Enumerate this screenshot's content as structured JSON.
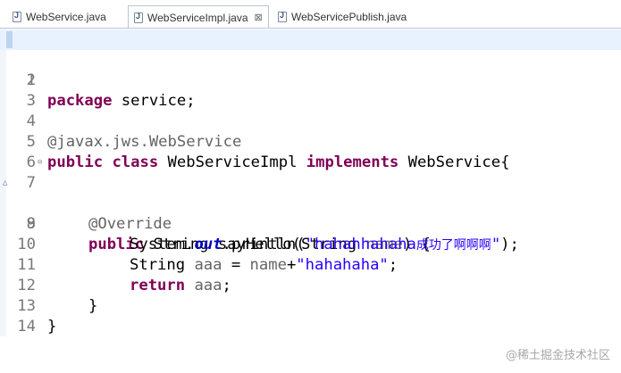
{
  "tabs": [
    {
      "label": "WebService.java",
      "active": false
    },
    {
      "label": "WebServiceImpl.java",
      "active": true,
      "close": "⊠"
    },
    {
      "label": "WebServicePublish.java",
      "active": false
    }
  ],
  "lines": {
    "l1": {
      "num": "1",
      "kw": "package",
      "rest": " service;"
    },
    "l2": {
      "num": "2"
    },
    "l3": {
      "num": "3"
    },
    "l4": {
      "num": "4",
      "ann": "@javax.jws.WebService"
    },
    "l5": {
      "num": "5",
      "kw1": "public",
      "kw2": "class",
      "name": " WebServiceImpl ",
      "kw3": "implements",
      "rest": " WebService{"
    },
    "l6": {
      "num": "6"
    },
    "l7": {
      "num": "7",
      "ann": "@Override"
    },
    "l8": {
      "num": "8",
      "kw": "public",
      "rest1": " String sayHello(String ",
      "param": "name",
      "rest2": ") {"
    },
    "l9": {
      "num": "9",
      "pre": "System.",
      "field": "out",
      "mid": ".println(",
      "str1": "\"hahahhahaha",
      "str_cn": "成功了啊啊啊",
      "str2": "\"",
      "end": ");"
    },
    "l10": {
      "num": "10",
      "pre": "String ",
      "var": "aaa",
      "mid": " = ",
      "param": "name",
      "plus": "+",
      "str": "\"hahahaha\"",
      "end": ";"
    },
    "l11": {
      "num": "11",
      "kw": "return",
      "sp": " ",
      "var": "aaa",
      "end": ";"
    },
    "l12": {
      "num": "12",
      "text": "}"
    },
    "l13": {
      "num": "13",
      "text": "}"
    },
    "l14": {
      "num": "14"
    }
  },
  "markers": {
    "fold": "⊖",
    "override": "△"
  },
  "watermark": "@稀土掘金技术社区",
  "colors": {
    "keyword": "#7f0055",
    "annotation": "#646464",
    "string": "#2a00ff",
    "field": "#0000c0",
    "current_line": "#e8f2fe"
  }
}
